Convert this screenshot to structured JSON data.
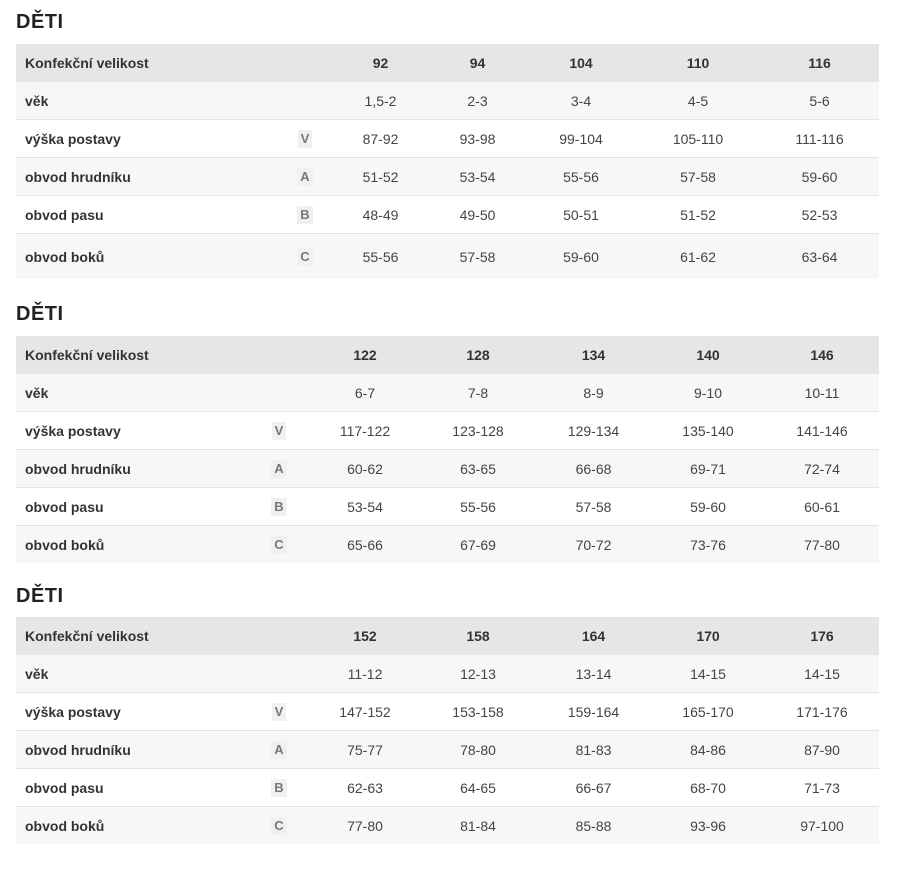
{
  "tables": [
    {
      "title": "DĚTI",
      "header_label": "Konfekční velikost",
      "sizes": [
        "92",
        "94",
        "104",
        "110",
        "116"
      ],
      "rows": [
        {
          "label": "věk",
          "code": "",
          "values": [
            "1,5-2",
            "2-3",
            "3-4",
            "4-5",
            "5-6"
          ]
        },
        {
          "label": "výška postavy",
          "code": "V",
          "values": [
            "87-92",
            "93-98",
            "99-104",
            "105-110",
            "111-116"
          ]
        },
        {
          "label": "obvod hrudníku",
          "code": "A",
          "values": [
            "51-52",
            "53-54",
            "55-56",
            "57-58",
            "59-60"
          ]
        },
        {
          "label": "obvod pasu",
          "code": "B",
          "values": [
            "48-49",
            "49-50",
            "50-51",
            "51-52",
            "52-53"
          ]
        },
        {
          "label": "obvod boků",
          "code": "C",
          "values": [
            "55-56",
            "57-58",
            "59-60",
            "61-62",
            "63-64"
          ]
        }
      ]
    },
    {
      "title": "DĚTI",
      "header_label": "Konfekční velikost",
      "sizes": [
        "122",
        "128",
        "134",
        "140",
        "146"
      ],
      "rows": [
        {
          "label": "věk",
          "code": "",
          "values": [
            "6-7",
            "7-8",
            "8-9",
            "9-10",
            "10-11"
          ]
        },
        {
          "label": "výška postavy",
          "code": "V",
          "values": [
            "117-122",
            "123-128",
            "129-134",
            "135-140",
            "141-146"
          ]
        },
        {
          "label": "obvod hrudníku",
          "code": "A",
          "values": [
            "60-62",
            "63-65",
            "66-68",
            "69-71",
            "72-74"
          ]
        },
        {
          "label": "obvod pasu",
          "code": "B",
          "values": [
            "53-54",
            "55-56",
            "57-58",
            "59-60",
            "60-61"
          ]
        },
        {
          "label": "obvod boků",
          "code": "C",
          "values": [
            "65-66",
            "67-69",
            "70-72",
            "73-76",
            "77-80"
          ]
        }
      ]
    },
    {
      "title": "DĚTI",
      "header_label": "Konfekční velikost",
      "sizes": [
        "152",
        "158",
        "164",
        "170",
        "176"
      ],
      "rows": [
        {
          "label": "věk",
          "code": "",
          "values": [
            "11-12",
            "12-13",
            "13-14",
            "14-15",
            "14-15"
          ]
        },
        {
          "label": "výška postavy",
          "code": "V",
          "values": [
            "147-152",
            "153-158",
            "159-164",
            "165-170",
            "171-176"
          ]
        },
        {
          "label": "obvod hrudníku",
          "code": "A",
          "values": [
            "75-77",
            "78-80",
            "81-83",
            "84-86",
            "87-90"
          ]
        },
        {
          "label": "obvod pasu",
          "code": "B",
          "values": [
            "62-63",
            "64-65",
            "66-67",
            "68-70",
            "71-73"
          ]
        },
        {
          "label": "obvod boků",
          "code": "C",
          "values": [
            "77-80",
            "81-84",
            "85-88",
            "93-96",
            "97-100"
          ]
        }
      ]
    }
  ]
}
